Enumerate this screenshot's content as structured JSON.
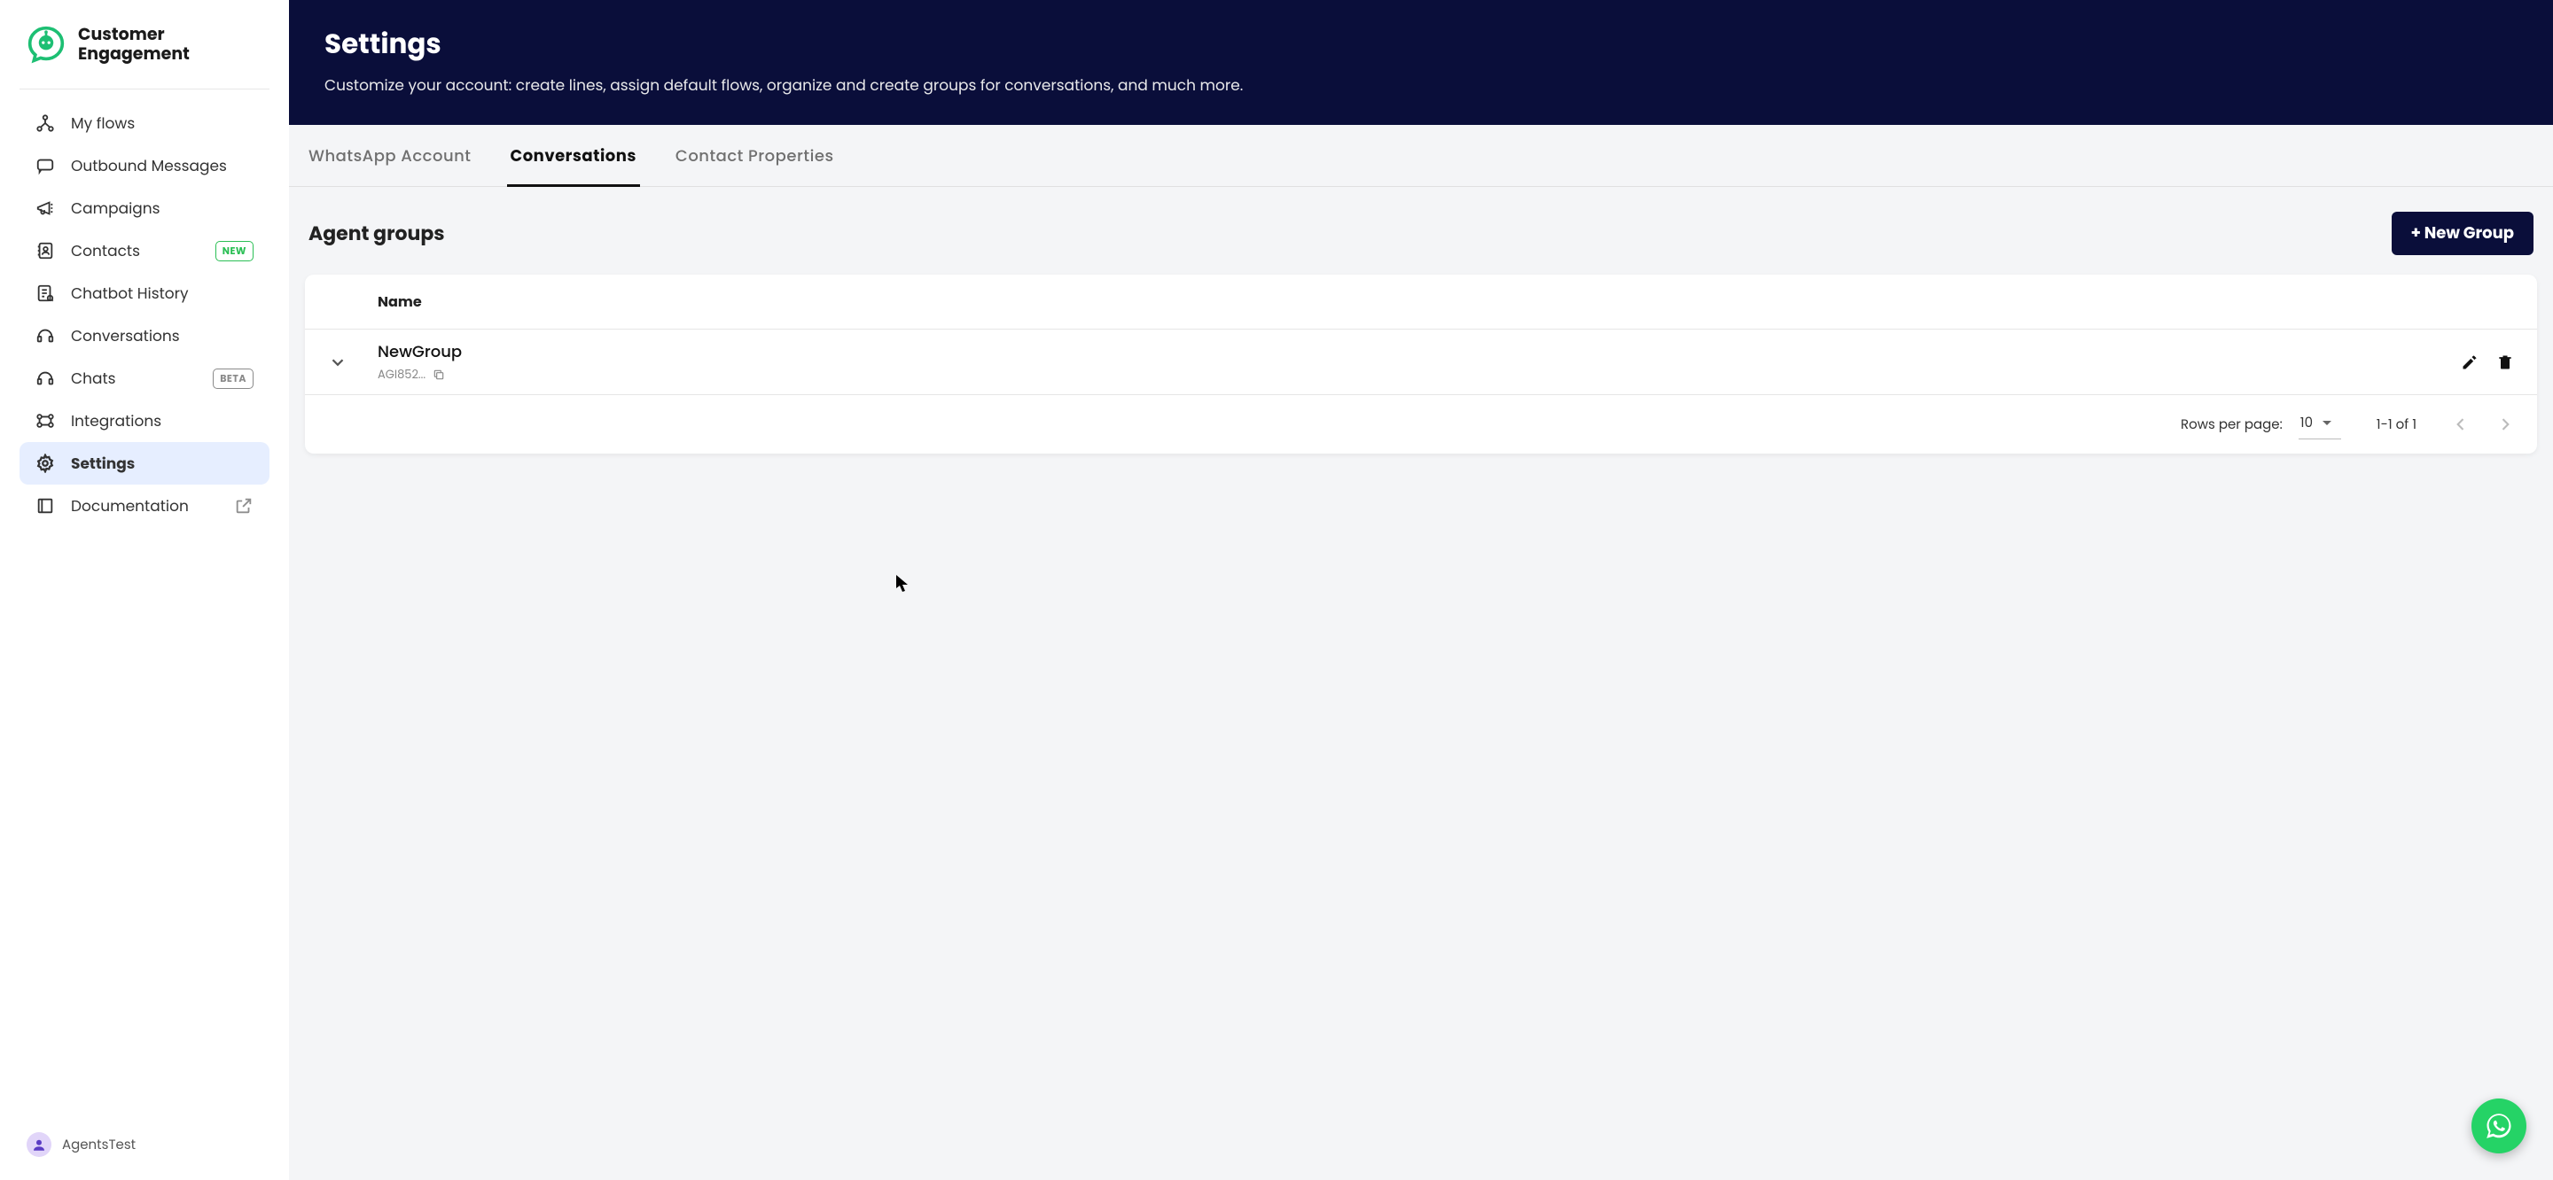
{
  "brand": {
    "line1": "Customer",
    "line2": "Engagement"
  },
  "sidebar": {
    "items": [
      {
        "label": "My flows"
      },
      {
        "label": "Outbound Messages"
      },
      {
        "label": "Campaigns"
      },
      {
        "label": "Contacts",
        "badge": "NEW"
      },
      {
        "label": "Chatbot History"
      },
      {
        "label": "Conversations"
      },
      {
        "label": "Chats",
        "badge": "BETA"
      },
      {
        "label": "Integrations"
      },
      {
        "label": "Settings"
      },
      {
        "label": "Documentation"
      }
    ]
  },
  "user": {
    "name": "AgentsTest"
  },
  "header": {
    "title": "Settings",
    "subtitle": "Customize your account: create lines, assign default flows, organize and create groups for conversations, and much more."
  },
  "tabs": [
    {
      "label": "WhatsApp Account"
    },
    {
      "label": "Conversations"
    },
    {
      "label": "Contact Properties"
    }
  ],
  "section": {
    "title": "Agent groups",
    "new_button": "+ New Group",
    "table": {
      "col_name": "Name",
      "rows": [
        {
          "name": "NewGroup",
          "id": "AGI852..."
        }
      ],
      "pager": {
        "rows_label": "Rows per page:",
        "page_size": "10",
        "range": "1-1 of 1"
      }
    }
  }
}
